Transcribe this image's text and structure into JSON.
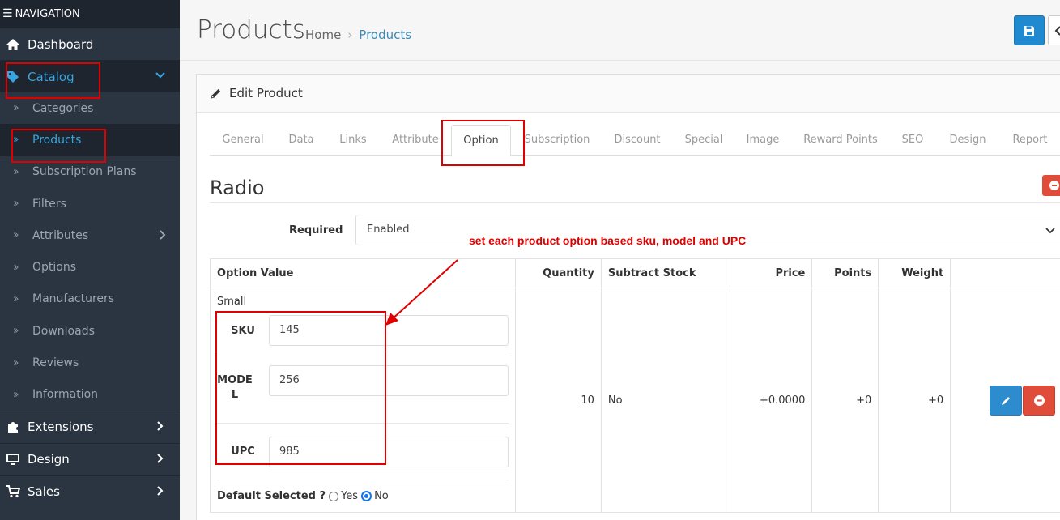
{
  "nav": {
    "header": "NAVIGATION",
    "items": [
      {
        "label": "Dashboard"
      },
      {
        "label": "Catalog"
      },
      {
        "label": "Extensions"
      },
      {
        "label": "Design"
      },
      {
        "label": "Sales"
      }
    ],
    "catalog_sub": [
      {
        "label": "Categories"
      },
      {
        "label": "Products"
      },
      {
        "label": "Subscription Plans"
      },
      {
        "label": "Filters"
      },
      {
        "label": "Attributes"
      },
      {
        "label": "Options"
      },
      {
        "label": "Manufacturers"
      },
      {
        "label": "Downloads"
      },
      {
        "label": "Reviews"
      },
      {
        "label": "Information"
      }
    ]
  },
  "header": {
    "title": "Products",
    "breadcrumb": [
      "Home",
      "Products"
    ]
  },
  "panel": {
    "title": "Edit Product",
    "tabs": [
      "General",
      "Data",
      "Links",
      "Attribute",
      "Option",
      "Subscription",
      "Discount",
      "Special",
      "Image",
      "Reward Points",
      "SEO",
      "Design",
      "Report"
    ],
    "active_tab": "Option"
  },
  "option": {
    "name": "Radio",
    "required_label": "Required",
    "required_value": "Enabled",
    "columns": [
      "Option Value",
      "Quantity",
      "Subtract Stock",
      "Price",
      "Points",
      "Weight"
    ],
    "row": {
      "value_name": "Small",
      "sku_label": "SKU",
      "sku": "145",
      "model_label": "MODEL",
      "model": "256",
      "upc_label": "UPC",
      "upc": "985",
      "default_label": "Default Selected ?",
      "yes": "Yes",
      "no": "No",
      "quantity": "10",
      "subtract": "No",
      "price": "+0.0000",
      "points": "+0",
      "weight": "+0"
    }
  },
  "annotation": {
    "text": "set each product option based sku, model and UPC"
  },
  "colors": {
    "sidebar": "#2b3542",
    "accent": "#37a6e0",
    "primary": "#1f8ad0",
    "danger": "#e04c3a",
    "annotation": "#e00000"
  }
}
